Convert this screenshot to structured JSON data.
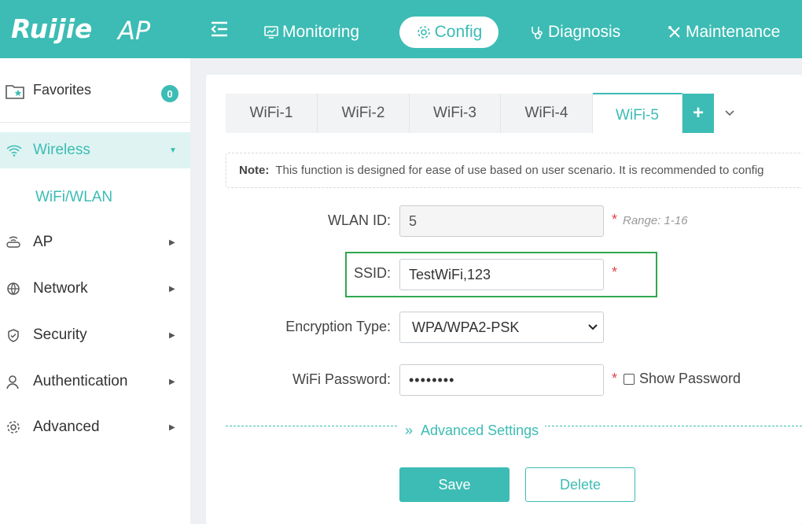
{
  "header": {
    "logo": "Ruijie",
    "product": "AP",
    "nav": [
      {
        "label": "Monitoring",
        "icon": "monitor-icon"
      },
      {
        "label": "Config",
        "icon": "gear-icon",
        "active": true
      },
      {
        "label": "Diagnosis",
        "icon": "stethoscope-icon"
      },
      {
        "label": "Maintenance",
        "icon": "tools-icon"
      }
    ]
  },
  "sidebar": {
    "favorites": {
      "label": "Favorites",
      "count": "0"
    },
    "items": [
      {
        "label": "Wireless",
        "icon": "wifi-icon",
        "active": true
      },
      {
        "label": "AP",
        "icon": "router-icon"
      },
      {
        "label": "Network",
        "icon": "globe-icon"
      },
      {
        "label": "Security",
        "icon": "shield-icon"
      },
      {
        "label": "Authentication",
        "icon": "user-icon"
      },
      {
        "label": "Advanced",
        "icon": "gear-icon"
      }
    ],
    "sub_item": "WiFi/WLAN"
  },
  "tabs": [
    "WiFi-1",
    "WiFi-2",
    "WiFi-3",
    "WiFi-4",
    "WiFi-5"
  ],
  "active_tab": "WiFi-5",
  "tab_add": "+",
  "note": {
    "prefix": "Note:",
    "text": "This function is designed for ease of use based on user scenario. It is recommended to config"
  },
  "form": {
    "wlan_id_label": "WLAN ID:",
    "wlan_id_value": "5",
    "wlan_id_hint": "Range: 1-16",
    "ssid_label": "SSID:",
    "ssid_value": "TestWiFi,123",
    "encryption_label": "Encryption Type:",
    "encryption_value": "WPA/WPA2-PSK",
    "password_label": "WiFi Password:",
    "password_value": "••••••••",
    "show_password_label": "Show Password",
    "required_mark": "*"
  },
  "advanced_settings": "Advanced Settings",
  "buttons": {
    "save": "Save",
    "delete": "Delete"
  },
  "colors": {
    "accent": "#3cbcb4",
    "highlight": "#2fa84f",
    "required": "#e0424a"
  }
}
